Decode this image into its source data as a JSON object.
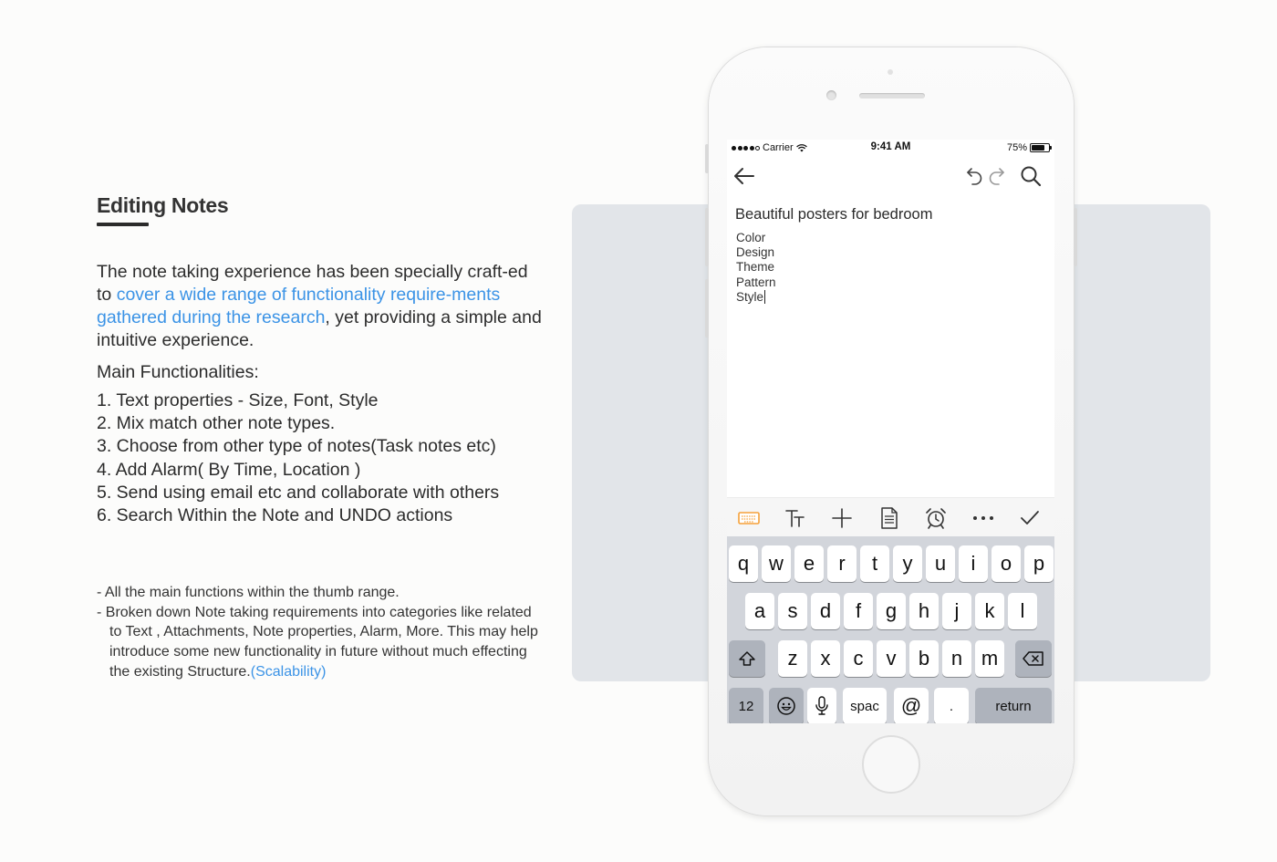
{
  "section": {
    "title": "Editing Notes",
    "intro_before": "The note taking experience has been specially craft-ed to ",
    "intro_highlight": "cover a wide range of functionality require-ments gathered during the research",
    "intro_after": ", yet providing a simple and intuitive experience.",
    "main_heading": "Main Functionalities:",
    "functionalities": [
      "1. Text properties - Size, Font, Style",
      "2. Mix match other note types.",
      "3. Choose from other type of notes(Task notes etc)",
      "4. Add Alarm( By Time, Location )",
      "5. Send using email etc and collaborate with others",
      "6. Search Within the Note and UNDO actions"
    ],
    "note_1": "- All the main functions within the thumb range.",
    "note_2": "- Broken down Note taking requirements into categories like related to Text , Attachments, Note properties, Alarm, More. This may help introduce some new functionality in future without much effecting  the existing Structure.",
    "note_2_highlight": "(Scalability)"
  },
  "phone": {
    "status": {
      "carrier": "Carrier",
      "time": "9:41 AM",
      "battery": "75%",
      "battery_level": 0.75
    },
    "note": {
      "title": "Beautiful posters for bedroom",
      "lines": [
        "Color",
        "Design",
        "Theme",
        "Pattern",
        "Style"
      ]
    },
    "toolbar_icons": [
      "keyboard-icon",
      "text-size-icon",
      "plus-icon",
      "document-icon",
      "alarm-clock-icon",
      "more-icon",
      "check-icon"
    ],
    "keyboard": {
      "row1": [
        "q",
        "w",
        "e",
        "r",
        "t",
        "y",
        "u",
        "i",
        "o",
        "p"
      ],
      "row2": [
        "a",
        "s",
        "d",
        "f",
        "g",
        "h",
        "j",
        "k",
        "l"
      ],
      "row3": [
        "z",
        "x",
        "c",
        "v",
        "b",
        "n",
        "m"
      ],
      "numbers_key": "12",
      "space_key": "spac",
      "at_key": "@",
      "dot_key": ".",
      "return_key": "return"
    }
  },
  "colors": {
    "accent_blue": "#3b93e6",
    "toolbar_orange": "#f5a13a",
    "backdrop": "#e2e5e9"
  }
}
